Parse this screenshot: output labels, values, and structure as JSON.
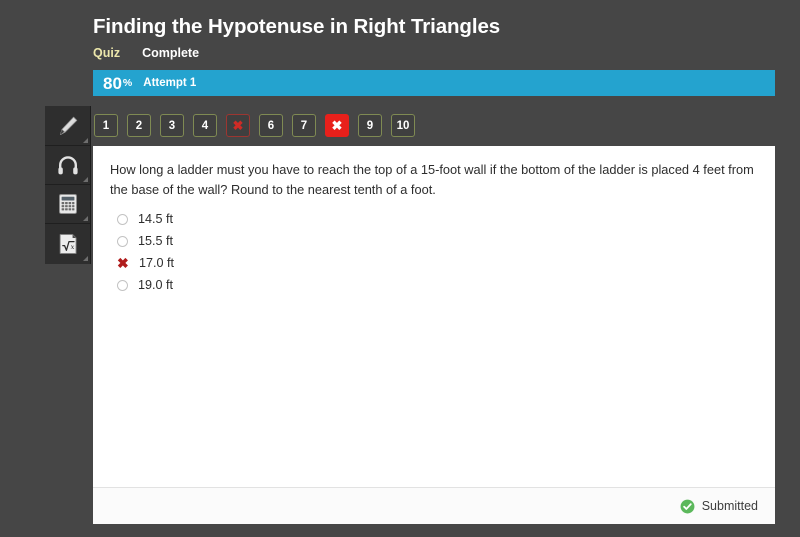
{
  "header": {
    "title": "Finding the Hypotenuse in Right Triangles",
    "tabs": [
      {
        "label": "Quiz",
        "state": "active"
      },
      {
        "label": "Complete",
        "state": "plain"
      }
    ]
  },
  "progress": {
    "score": "80",
    "percent_symbol": "%",
    "attempt_label": "Attempt 1",
    "bar_color": "#24a3cf"
  },
  "question_nav": {
    "items": [
      {
        "label": "1",
        "state": "normal"
      },
      {
        "label": "2",
        "state": "normal"
      },
      {
        "label": "3",
        "state": "normal"
      },
      {
        "label": "4",
        "state": "normal"
      },
      {
        "label": "✖",
        "state": "wrong"
      },
      {
        "label": "6",
        "state": "normal"
      },
      {
        "label": "7",
        "state": "normal"
      },
      {
        "label": "✖",
        "state": "wrong-current"
      },
      {
        "label": "9",
        "state": "normal"
      },
      {
        "label": "10",
        "state": "normal"
      }
    ],
    "normal_border_color": "#7f8a53",
    "wrong_color": "#cf2b26",
    "wrong_current_bg": "#e8201b"
  },
  "tools": [
    {
      "icon": "pencil-icon"
    },
    {
      "icon": "headphones-icon"
    },
    {
      "icon": "calculator-icon"
    },
    {
      "icon": "formula-sqrt-icon"
    }
  ],
  "question": {
    "text": "How long a ladder must you have to reach the top of a 15-foot wall if the bottom of the ladder is placed 4 feet from the base of the wall? Round to the nearest tenth of a foot.",
    "options": [
      {
        "label": "14.5 ft",
        "marker": "radio"
      },
      {
        "label": "15.5 ft",
        "marker": "radio"
      },
      {
        "label": "17.0 ft",
        "marker": "x"
      },
      {
        "label": "19.0 ft",
        "marker": "radio"
      }
    ]
  },
  "footer": {
    "status_text": "Submitted",
    "status_icon": "check-circle-icon",
    "status_color": "#5cb85c"
  }
}
